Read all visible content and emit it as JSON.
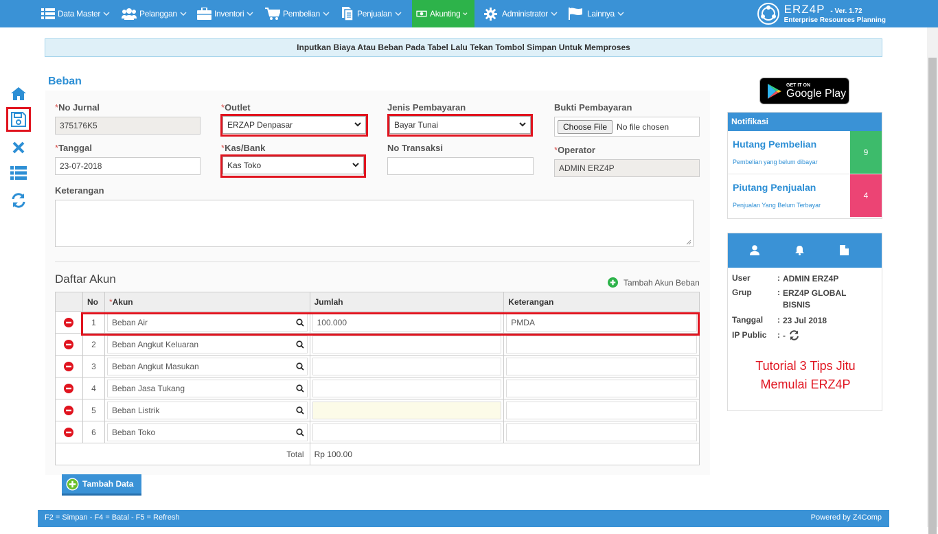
{
  "nav": {
    "items": [
      {
        "label": "Data Master",
        "icon": "list-icon"
      },
      {
        "label": "Pelanggan",
        "icon": "users-icon"
      },
      {
        "label": "Inventori",
        "icon": "briefcase-icon"
      },
      {
        "label": "Pembelian",
        "icon": "cart-icon"
      },
      {
        "label": "Penjualan",
        "icon": "document-icon"
      },
      {
        "label": "Akunting",
        "icon": "money-icon"
      },
      {
        "label": "Administrator",
        "icon": "gear-icon"
      },
      {
        "label": "Lainnya",
        "icon": "flag-icon"
      }
    ],
    "brand_name": "ERZ4P",
    "brand_version": "- Ver. 1.72",
    "brand_subtitle": "Enterprise Resources Planning"
  },
  "info_message": "Inputkan Biaya Atau Beban Pada Tabel Lalu Tekan Tombol Simpan Untuk Memproses",
  "page_title": "Beban",
  "form": {
    "no_jurnal_label": "No Jurnal",
    "no_jurnal_value": "375176K5",
    "outlet_label": "Outlet",
    "outlet_value": "ERZAP Denpasar",
    "jenis_label": "Jenis Pembayaran",
    "jenis_value": "Bayar Tunai",
    "bukti_label": "Bukti Pembayaran",
    "choose_file": "Choose File",
    "no_file": "No file chosen",
    "tanggal_label": "Tanggal",
    "tanggal_value": "23-07-2018",
    "kas_label": "Kas/Bank",
    "kas_value": "Kas Toko",
    "no_transaksi_label": "No Transaksi",
    "no_transaksi_value": "",
    "operator_label": "Operator",
    "operator_value": "ADMIN ERZ4P",
    "keterangan_label": "Keterangan",
    "required_mark": "*"
  },
  "daftar": {
    "title": "Daftar Akun",
    "add_akun": "Tambah Akun Beban",
    "headers": {
      "no": "No",
      "akun": "Akun",
      "jumlah": "Jumlah",
      "keterangan": "Keterangan"
    },
    "rows": [
      {
        "no": "1",
        "akun": "Beban Air",
        "jumlah": "100.000",
        "keterangan": "PMDA"
      },
      {
        "no": "2",
        "akun": "Beban Angkut Keluaran",
        "jumlah": "",
        "keterangan": ""
      },
      {
        "no": "3",
        "akun": "Beban Angkut Masukan",
        "jumlah": "",
        "keterangan": ""
      },
      {
        "no": "4",
        "akun": "Beban Jasa Tukang",
        "jumlah": "",
        "keterangan": ""
      },
      {
        "no": "5",
        "akun": "Beban Listrik",
        "jumlah": "",
        "keterangan": ""
      },
      {
        "no": "6",
        "akun": "Beban Toko",
        "jumlah": "",
        "keterangan": ""
      }
    ],
    "total_label": "Total",
    "total_value": "Rp 100.00"
  },
  "add_data_button": "Tambah Data",
  "footer": {
    "shortcuts": "F2 = Simpan - F4 = Batal - F5 = Refresh",
    "powered": "Powered by Z4Comp"
  },
  "google_play": {
    "small": "GET IT ON",
    "big": "Google Play"
  },
  "notifikasi": {
    "title": "Notifikasi",
    "items": [
      {
        "title": "Hutang Pembelian",
        "sub": "Pembelian yang belum dibayar",
        "count": "9",
        "color": "#3dbb6b"
      },
      {
        "title": "Piutang Penjualan",
        "sub": "Penjualan Yang Belum Terbayar",
        "count": "4",
        "color": "#ec4474"
      }
    ]
  },
  "user_info": {
    "user_label": "User",
    "user_value": "ADMIN ERZ4P",
    "grup_label": "Grup",
    "grup_value": "ERZ4P GLOBAL BISNIS",
    "tanggal_label": "Tanggal",
    "tanggal_value": "23 Jul 2018",
    "ip_label": "IP Public",
    "ip_value": "-",
    "sep": ":"
  },
  "tutorial_text": "Tutorial 3 Tips Jitu Memulai ERZ4P",
  "colors": {
    "primary": "#3a92d6",
    "active_nav": "#2db34a",
    "highlight": "#e0141f",
    "danger": "#e0141f"
  }
}
